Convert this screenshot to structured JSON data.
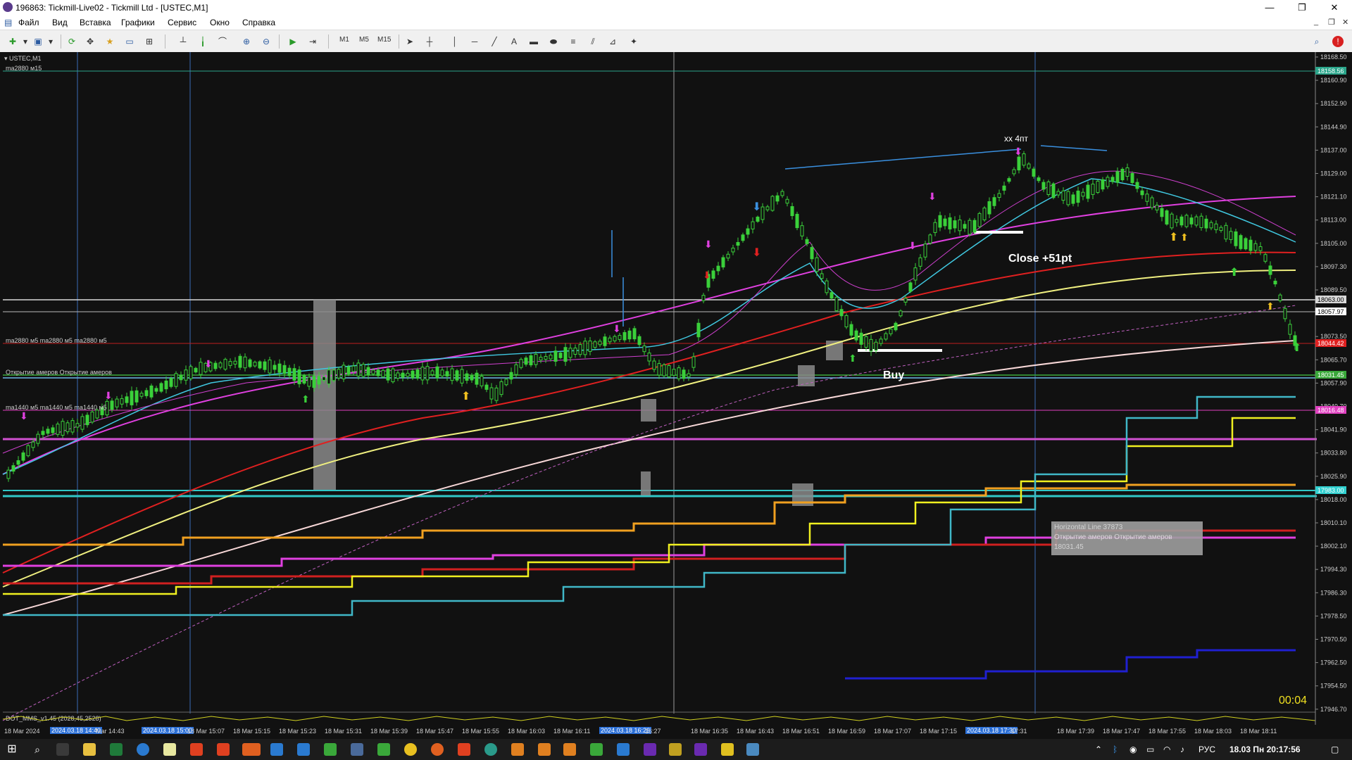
{
  "window": {
    "title": "196863: Tickmill-Live02 - Tickmill Ltd - [USTEC,M1]",
    "minimize": "—",
    "restore": "❐",
    "close": "✕"
  },
  "menu": [
    "Файл",
    "Вид",
    "Вставка",
    "Графики",
    "Сервис",
    "Окно",
    "Справка"
  ],
  "toolbar": {
    "timeframes": [
      "M1",
      "M5",
      "M15"
    ],
    "text_tool": "A"
  },
  "chart": {
    "symbol_label": "USTEC,M1",
    "indicator_labels": {
      "ma2880_m15": "ma2880 м15",
      "ma2880_m5": "ma2880 м5 ma2880 м5 ma2880 м5",
      "open_amer": "Открытие амеров   Открытие амеров",
      "ma1440_m5": "ma1440 м5 ma1440 м5 ma1440 м5",
      "subwindow": "DOT_MMS_v1.45 (2028,45,2528)"
    },
    "annotations": {
      "xx4pt": "хх 4пт",
      "close": "Close +51pt",
      "buy": "Buy"
    },
    "tooltip": {
      "line1": "Horizontal Line 37873",
      "line2": "Открытие амеров   Открытие амеров",
      "line3": "18031.45"
    },
    "timer": "00:04",
    "price_axis": [
      "18168.50",
      "18160.90",
      "18152.90",
      "18144.90",
      "18137.00",
      "18129.00",
      "18121.10",
      "18113.00",
      "18105.00",
      "18097.30",
      "18089.50",
      "18081.50",
      "18073.50",
      "18065.70",
      "18057.90",
      "18049.70",
      "18041.90",
      "18033.80",
      "18025.90",
      "18018.00",
      "18010.10",
      "18002.10",
      "17994.30",
      "17986.30",
      "17978.50",
      "17970.50",
      "17962.50",
      "17954.50",
      "17946.70"
    ],
    "price_tags": [
      {
        "text": "18158.56",
        "color": "#2aa58a"
      },
      {
        "text": "18063.00",
        "color": "#d8d8d8"
      },
      {
        "text": "18057.97",
        "color": "#ffffff"
      },
      {
        "text": "18044.42",
        "color": "#e02020"
      },
      {
        "text": "18031.45",
        "color": "#3aa83a"
      },
      {
        "text": "18016.48",
        "color": "#e040c0"
      },
      {
        "text": "17983.00",
        "color": "#30d0d0"
      }
    ],
    "time_axis": [
      {
        "text": "18 Mar 2024",
        "hl": false
      },
      {
        "text": "2024.03.18 14:40",
        "hl": true
      },
      {
        "text": "Mar 14:43",
        "hl": false
      },
      {
        "text": "2024.03.18 15:00",
        "hl": true
      },
      {
        "text": "18 Mar 15:07",
        "hl": false
      },
      {
        "text": "18 Mar 15:15",
        "hl": false
      },
      {
        "text": "18 Mar 15:23",
        "hl": false
      },
      {
        "text": "18 Mar 15:31",
        "hl": false
      },
      {
        "text": "18 Mar 15:39",
        "hl": false
      },
      {
        "text": "18 Mar 15:47",
        "hl": false
      },
      {
        "text": "18 Mar 15:55",
        "hl": false
      },
      {
        "text": "18 Mar 16:03",
        "hl": false
      },
      {
        "text": "18 Mar 16:11",
        "hl": false
      },
      {
        "text": "2024.03.18 16:26",
        "hl": true
      },
      {
        "text": "16:27",
        "hl": false
      },
      {
        "text": "18 Mar 16:35",
        "hl": false
      },
      {
        "text": "18 Mar 16:43",
        "hl": false
      },
      {
        "text": "18 Mar 16:51",
        "hl": false
      },
      {
        "text": "18 Mar 16:59",
        "hl": false
      },
      {
        "text": "18 Mar 17:07",
        "hl": false
      },
      {
        "text": "18 Mar 17:15",
        "hl": false
      },
      {
        "text": "2024.03.18 17:30",
        "hl": true
      },
      {
        "text": "17:31",
        "hl": false
      },
      {
        "text": "18 Mar 17:39",
        "hl": false
      },
      {
        "text": "18 Mar 17:47",
        "hl": false
      },
      {
        "text": "18 Mar 17:55",
        "hl": false
      },
      {
        "text": "18 Mar 18:03",
        "hl": false
      },
      {
        "text": "18 Mar 18:11",
        "hl": false
      }
    ]
  },
  "taskbar": {
    "lang": "РУС",
    "clock": "18.03 Пн 20:17:56"
  }
}
